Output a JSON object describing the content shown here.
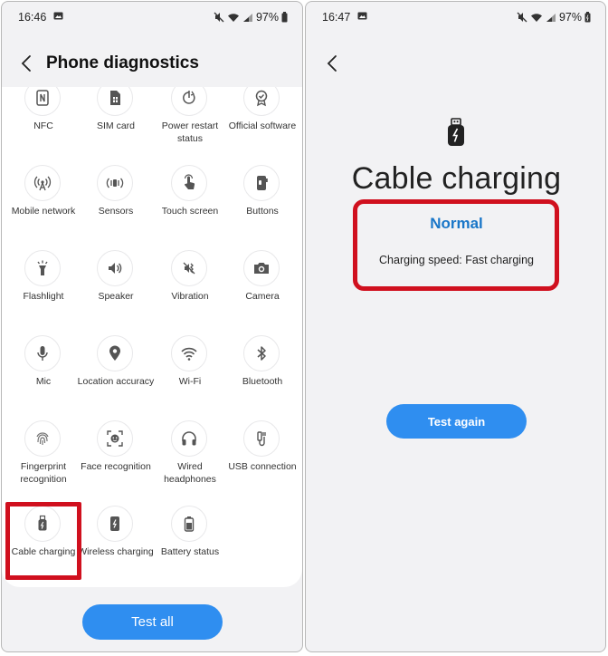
{
  "left": {
    "status_bar": {
      "time": "16:46",
      "battery": "97%"
    },
    "header": {
      "title": "Phone diagnostics"
    },
    "tests": [
      {
        "label": "NFC",
        "icon": "nfc-icon"
      },
      {
        "label": "SIM card",
        "icon": "sim-card-icon"
      },
      {
        "label": "Power restart status",
        "icon": "power-restart-icon"
      },
      {
        "label": "Official software",
        "icon": "official-software-icon"
      },
      {
        "label": "Mobile network",
        "icon": "mobile-network-icon"
      },
      {
        "label": "Sensors",
        "icon": "sensors-icon"
      },
      {
        "label": "Touch screen",
        "icon": "touch-screen-icon"
      },
      {
        "label": "Buttons",
        "icon": "buttons-icon"
      },
      {
        "label": "Flashlight",
        "icon": "flashlight-icon"
      },
      {
        "label": "Speaker",
        "icon": "speaker-icon"
      },
      {
        "label": "Vibration",
        "icon": "vibration-icon"
      },
      {
        "label": "Camera",
        "icon": "camera-icon"
      },
      {
        "label": "Mic",
        "icon": "mic-icon"
      },
      {
        "label": "Location accuracy",
        "icon": "location-icon"
      },
      {
        "label": "Wi-Fi",
        "icon": "wifi-icon"
      },
      {
        "label": "Bluetooth",
        "icon": "bluetooth-icon"
      },
      {
        "label": "Fingerprint recognition",
        "icon": "fingerprint-icon"
      },
      {
        "label": "Face recognition",
        "icon": "face-recognition-icon"
      },
      {
        "label": "Wired headphones",
        "icon": "headphones-icon"
      },
      {
        "label": "USB connection",
        "icon": "usb-connection-icon"
      },
      {
        "label": "Cable charging",
        "icon": "cable-charging-icon"
      },
      {
        "label": "Wireless charging",
        "icon": "wireless-charging-icon"
      },
      {
        "label": "Battery status",
        "icon": "battery-status-icon"
      }
    ],
    "test_all_label": "Test all"
  },
  "right": {
    "status_bar": {
      "time": "16:47",
      "battery": "97%"
    },
    "result": {
      "title": "Cable charging",
      "status": "Normal",
      "detail": "Charging speed: Fast charging",
      "icon": "cable-charging-icon"
    },
    "test_again_label": "Test again"
  },
  "colors": {
    "accent": "#2f8ef0",
    "status_text": "#1976c8",
    "highlight": "#d0101e",
    "background": "#f2f2f4",
    "card": "#ffffff"
  }
}
